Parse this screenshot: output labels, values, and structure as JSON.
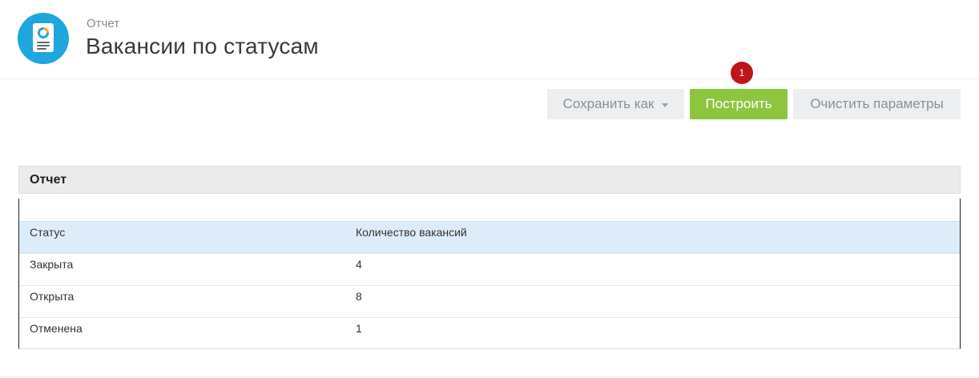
{
  "header": {
    "subtitle": "Отчет",
    "title": "Вакансии по статусам",
    "icon": "report-document-icon",
    "icon_color": "#1ea6dd"
  },
  "toolbar": {
    "save_label": "Сохранить как",
    "build_label": "Построить",
    "clear_label": "Очистить параметры",
    "build_color": "#8cc63f"
  },
  "badge": {
    "value": "1",
    "color": "#c0141b"
  },
  "report": {
    "title": "Отчет",
    "columns": [
      "Статус",
      "Количество вакансий"
    ],
    "rows": [
      [
        "Закрыта",
        "4"
      ],
      [
        "Открыта",
        "8"
      ],
      [
        "Отменена",
        "1"
      ]
    ]
  }
}
